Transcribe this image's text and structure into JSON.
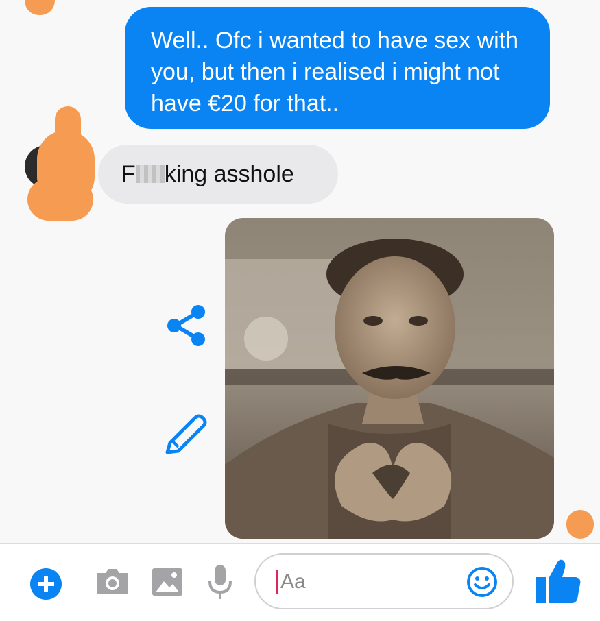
{
  "conversation": {
    "sent_message": "Well.. Ofc i wanted to have sex with you, but then i realised i might not have €20 for that..",
    "received_message_prefix": "F",
    "received_message_suffix": "king asshole",
    "attachment": {
      "kind": "photo",
      "subject": "vintage sepia portrait of a man with mustache making a heart shape with his hands"
    },
    "attachment_actions": [
      {
        "name": "share",
        "icon": "share-icon"
      },
      {
        "name": "edit",
        "icon": "pencil-icon"
      }
    ]
  },
  "composer": {
    "placeholder": "Aa",
    "icons": [
      "plus-icon",
      "camera-icon",
      "image-icon",
      "microphone-icon",
      "emoji-icon",
      "thumbs-up-icon"
    ]
  },
  "colors": {
    "accent": "#0b84f3",
    "incoming_bubble": "#e9e9ec",
    "redaction_scribble": "#f59b52"
  }
}
